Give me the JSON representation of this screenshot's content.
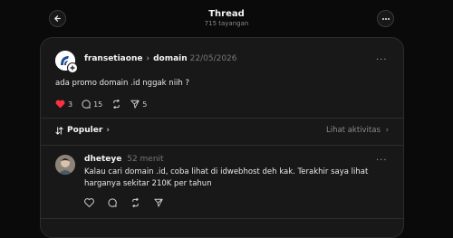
{
  "header": {
    "title": "Thread",
    "subtitle": "715 tayangan"
  },
  "post": {
    "username": "fransetiaone",
    "topic": "domain",
    "date": "22/05/2026",
    "text": "ada promo domain .id nggak niih ?",
    "likes": "3",
    "comments": "15",
    "shares": "5",
    "liked_color": "#ff3040"
  },
  "sort": {
    "label": "Populer",
    "activity_label": "Lihat aktivitas"
  },
  "reply": {
    "username": "dheteye",
    "time": "52 menit",
    "text": "Kalau cari domain .id, coba lihat di idwebhost deh kak. Terakhir saya lihat harganya sekitar 210K per tahun"
  },
  "icons": [
    "back-arrow-icon",
    "more-icon",
    "heart-icon",
    "comment-icon",
    "repost-icon",
    "share-icon",
    "sort-icon",
    "chevron-right-icon"
  ]
}
